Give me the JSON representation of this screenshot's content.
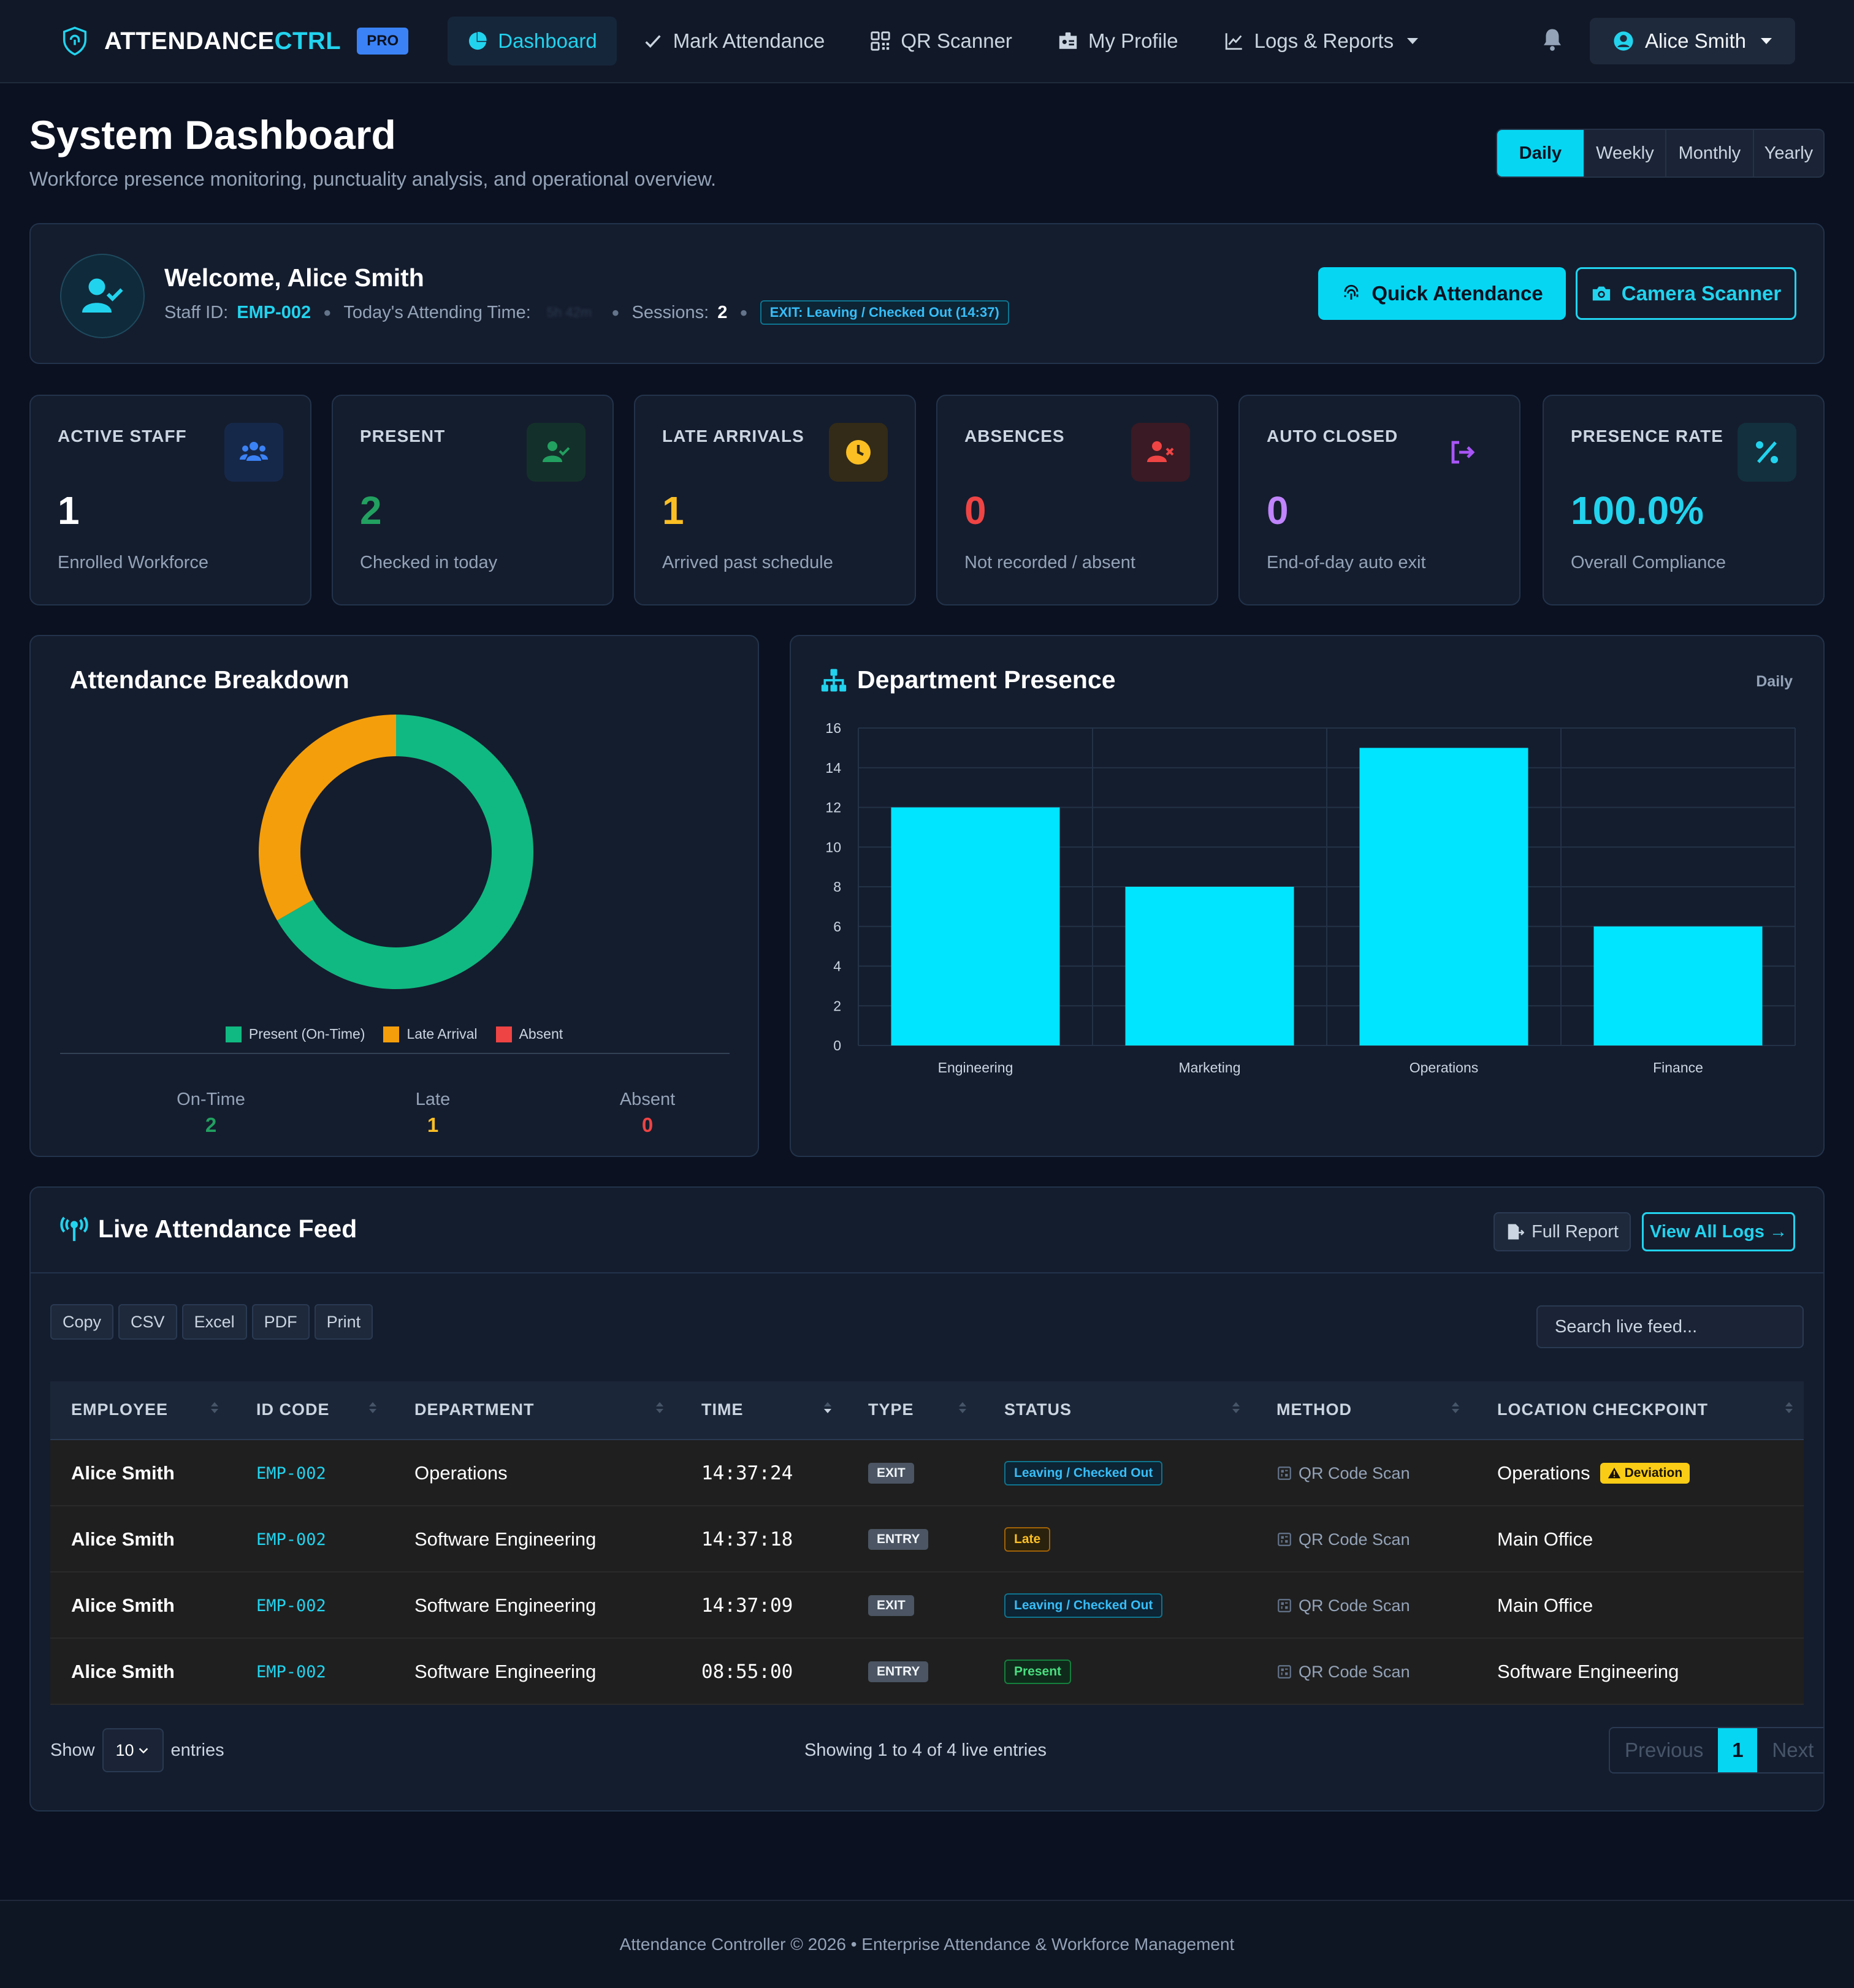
{
  "nav": {
    "brand_main": "ATTENDANCE",
    "brand_accent": "CTRL",
    "brand_badge": "PRO",
    "items": [
      {
        "label": "Dashboard",
        "icon": "pie-chart-icon",
        "active": true
      },
      {
        "label": "Mark Attendance",
        "icon": "check-icon"
      },
      {
        "label": "QR Scanner",
        "icon": "qr-icon"
      },
      {
        "label": "My Profile",
        "icon": "id-card-icon"
      },
      {
        "label": "Logs & Reports",
        "icon": "line-chart-icon"
      }
    ],
    "user_name": "Alice Smith"
  },
  "header": {
    "title": "System Dashboard",
    "subtitle": "Workforce presence monitoring, punctuality analysis, and operational overview.",
    "periods": [
      "Daily",
      "Weekly",
      "Monthly",
      "Yearly"
    ],
    "active_period": "Daily"
  },
  "welcome": {
    "greeting": "Welcome, Alice Smith",
    "staff_id_label": "Staff ID:",
    "staff_id": "EMP-002",
    "attending_label": "Today's Attending Time:",
    "attending_value": "5h 42m",
    "sessions_label": "Sessions:",
    "sessions": "2",
    "status_badge": "EXIT: Leaving / Checked Out (14:37)",
    "quick_btn": "Quick Attendance",
    "camera_btn": "Camera Scanner"
  },
  "stats": [
    {
      "label": "ACTIVE STAFF",
      "value": "1",
      "desc": "Enrolled Workforce",
      "color": "#ffffff",
      "icon": "users-icon",
      "icon_color": "#3b82f6",
      "icon_bg": "#16284a"
    },
    {
      "label": "PRESENT",
      "value": "2",
      "desc": "Checked in today",
      "color": "#22a060",
      "icon": "user-check-icon",
      "icon_color": "#22a060",
      "icon_bg": "#14302a"
    },
    {
      "label": "LATE ARRIVALS",
      "value": "1",
      "desc": "Arrived past schedule",
      "color": "#fbbf24",
      "icon": "clock-icon",
      "icon_color": "#fbbf24",
      "icon_bg": "#332b17"
    },
    {
      "label": "ABSENCES",
      "value": "0",
      "desc": "Not recorded / absent",
      "color": "#ef4444",
      "icon": "user-x-icon",
      "icon_color": "#ef4444",
      "icon_bg": "#3a1a24"
    },
    {
      "label": "AUTO CLOSED",
      "value": "0",
      "desc": "End-of-day auto exit",
      "color": "#c084fc",
      "icon": "sign-out-icon",
      "icon_color": "#a855f7",
      "icon_bg": "#141d2e"
    },
    {
      "label": "PRESENCE RATE",
      "value": "100.0%",
      "desc": "Overall Compliance",
      "color": "#22d3ee",
      "icon": "percent-icon",
      "icon_color": "#22d3ee",
      "icon_bg": "#12303d"
    }
  ],
  "chart_data": [
    {
      "type": "pie",
      "title": "Attendance Breakdown",
      "categories": [
        "Present (On-Time)",
        "Late Arrival",
        "Absent"
      ],
      "values": [
        2,
        1,
        0
      ],
      "colors": [
        "#10b981",
        "#f59e0b",
        "#ef4444"
      ],
      "legend": "bottom",
      "summary": [
        {
          "label": "On-Time",
          "value": "2",
          "color": "#22a060"
        },
        {
          "label": "Late",
          "value": "1",
          "color": "#fbbf24"
        },
        {
          "label": "Absent",
          "value": "0",
          "color": "#ef4444"
        }
      ]
    },
    {
      "type": "bar",
      "title": "Department Presence",
      "period": "Daily",
      "categories": [
        "Engineering",
        "Marketing",
        "Operations",
        "Finance"
      ],
      "values": [
        12,
        8,
        15,
        6
      ],
      "ylim": [
        0,
        16
      ],
      "yticks": [
        0,
        2,
        4,
        6,
        8,
        10,
        12,
        14,
        16
      ],
      "color": "#00e5ff",
      "grid": true
    }
  ],
  "feed": {
    "title": "Live Attendance Feed",
    "full_report": "Full Report",
    "view_logs": "View All Logs →",
    "exports": [
      "Copy",
      "CSV",
      "Excel",
      "PDF",
      "Print"
    ],
    "search_placeholder": "Search live feed...",
    "columns": [
      "EMPLOYEE",
      "ID CODE",
      "DEPARTMENT",
      "TIME",
      "TYPE",
      "STATUS",
      "METHOD",
      "LOCATION CHECKPOINT"
    ],
    "rows": [
      {
        "employee": "Alice Smith",
        "id": "EMP-002",
        "department": "Operations",
        "time": "14:37:24",
        "type": "EXIT",
        "status": "Leaving / Checked Out",
        "status_kind": "leave",
        "method": "QR Code Scan",
        "location": "Operations",
        "flag": "Deviation"
      },
      {
        "employee": "Alice Smith",
        "id": "EMP-002",
        "department": "Software Engineering",
        "time": "14:37:18",
        "type": "ENTRY",
        "status": "Late",
        "status_kind": "late",
        "method": "QR Code Scan",
        "location": "Main Office",
        "flag": ""
      },
      {
        "employee": "Alice Smith",
        "id": "EMP-002",
        "department": "Software Engineering",
        "time": "14:37:09",
        "type": "EXIT",
        "status": "Leaving / Checked Out",
        "status_kind": "leave",
        "method": "QR Code Scan",
        "location": "Main Office",
        "flag": ""
      },
      {
        "employee": "Alice Smith",
        "id": "EMP-002",
        "department": "Software Engineering",
        "time": "08:55:00",
        "type": "ENTRY",
        "status": "Present",
        "status_kind": "present",
        "method": "QR Code Scan",
        "location": "Software Engineering",
        "flag": ""
      }
    ],
    "show_label": "Show",
    "entries_label": "entries",
    "page_size": "10",
    "showing_text": "Showing 1 to 4 of 4 live entries",
    "prev": "Previous",
    "page": "1",
    "next": "Next"
  },
  "footer": {
    "text": "Attendance Controller © 2026 • Enterprise Attendance & Workforce Management"
  }
}
